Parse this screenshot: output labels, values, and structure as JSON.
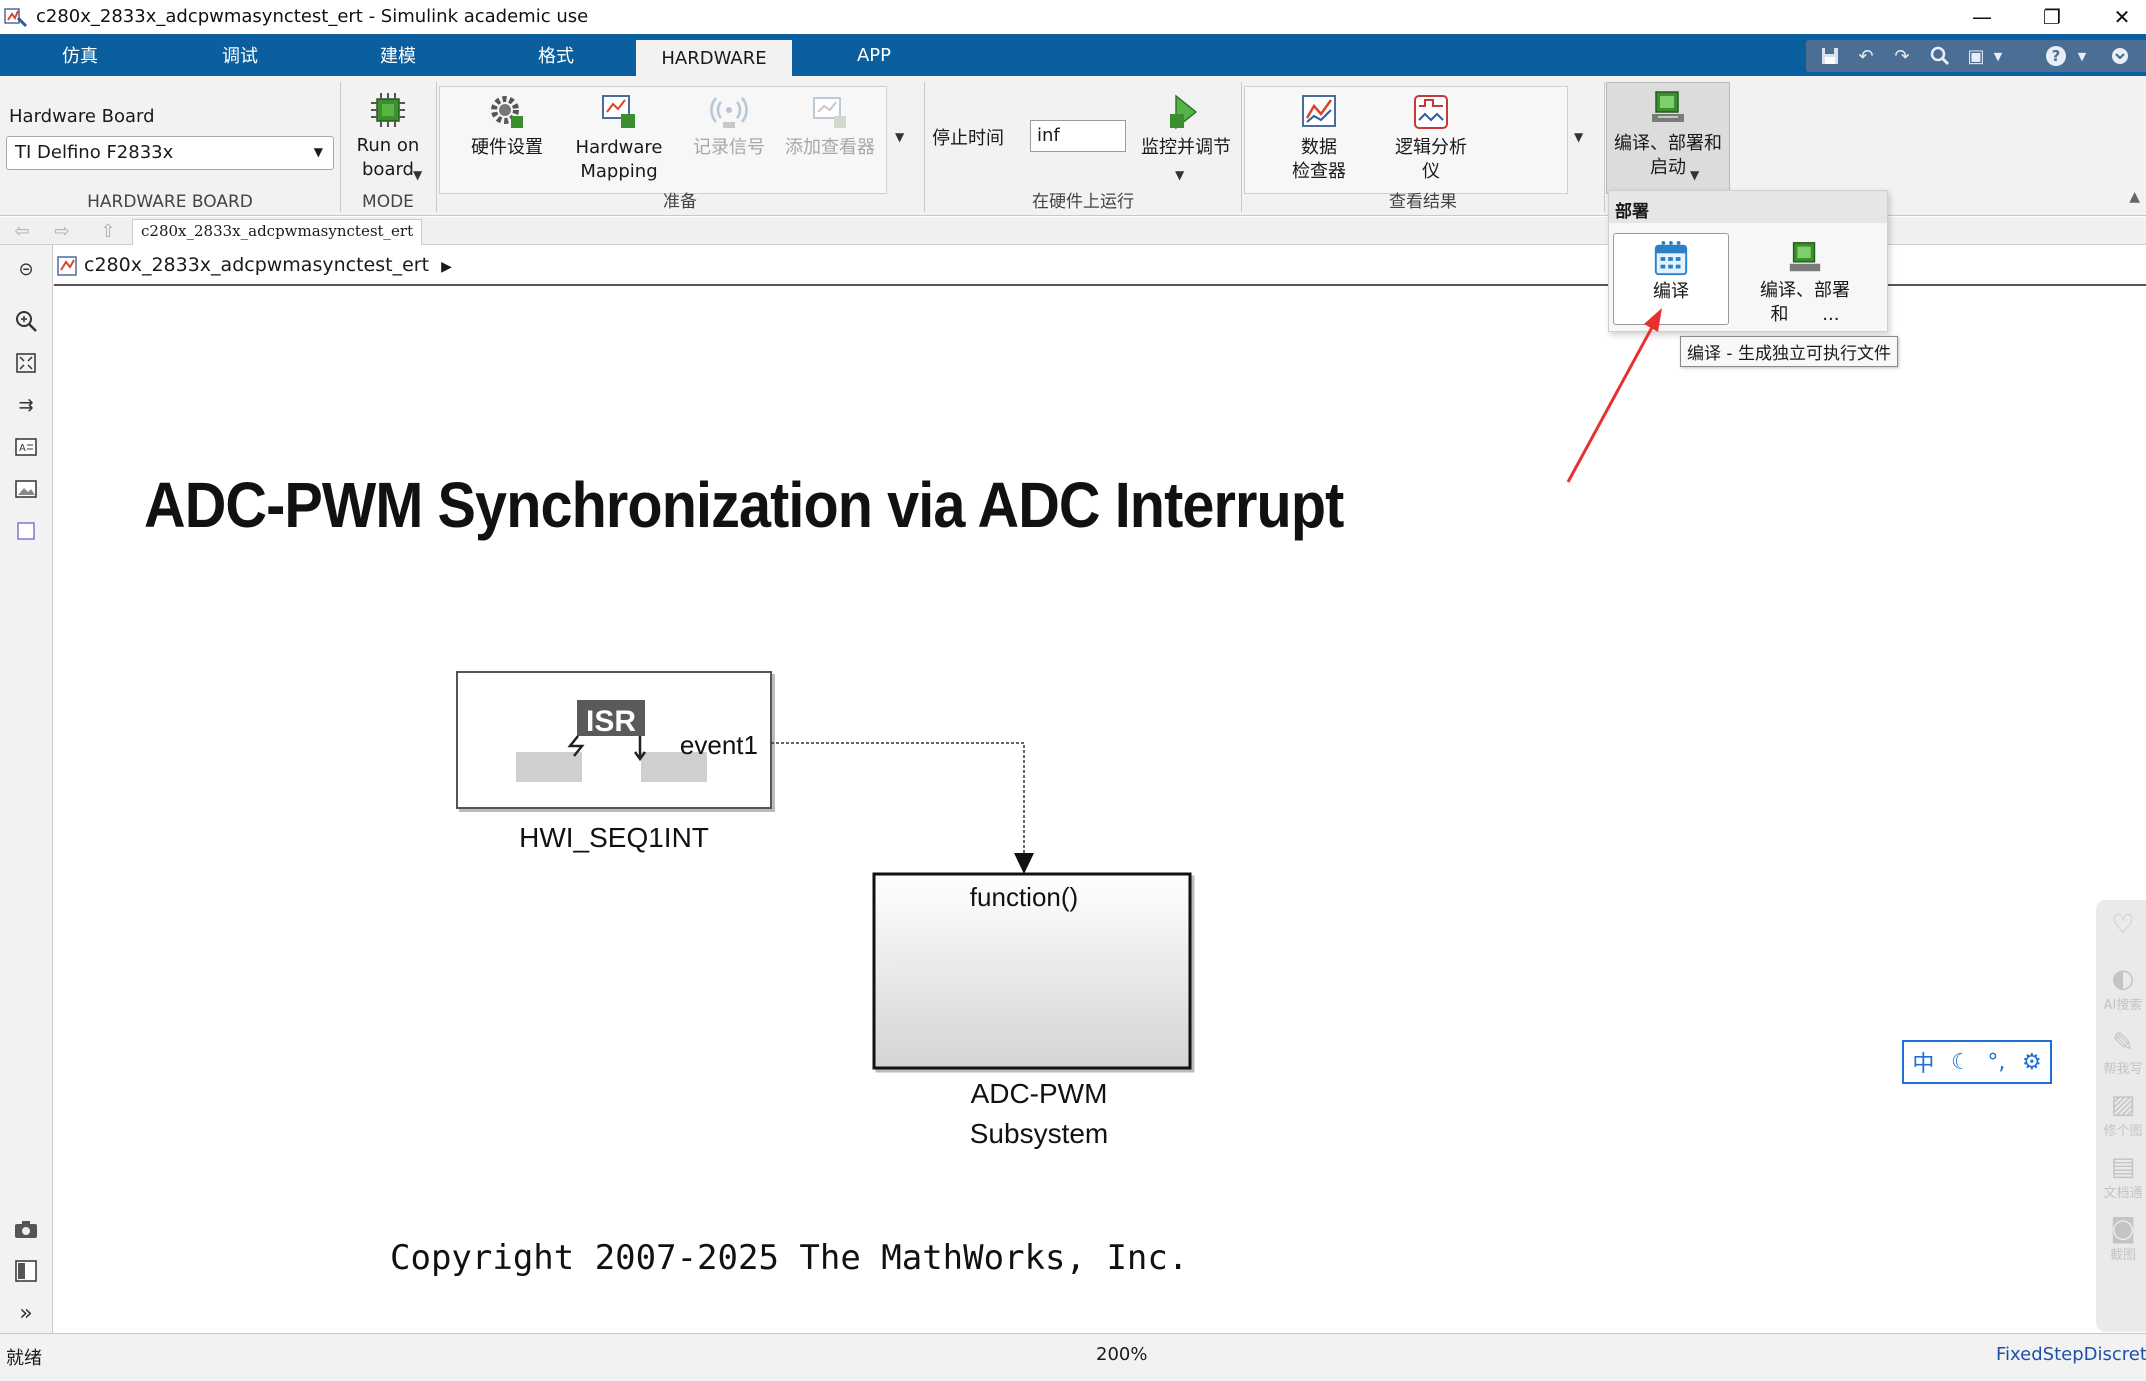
{
  "window": {
    "title": "c280x_2833x_adcpwmasynctest_ert - Simulink academic use",
    "minimize_glyph": "—",
    "restore_glyph": "❐",
    "close_glyph": "✕"
  },
  "tabs": [
    {
      "label": "仿真"
    },
    {
      "label": "调试"
    },
    {
      "label": "建模"
    },
    {
      "label": "格式"
    },
    {
      "label": "HARDWARE",
      "active": true
    },
    {
      "label": "APP"
    }
  ],
  "ribbon": {
    "hardware_board": {
      "label": "Hardware Board",
      "selected": "TI Delfino F2833x",
      "section": "HARDWARE BOARD"
    },
    "mode": {
      "run_on_board_line1": "Run on",
      "run_on_board_line2": "board",
      "section": "MODE"
    },
    "prepare": {
      "hardware_settings": "硬件设置",
      "hardware_mapping_line1": "Hardware",
      "hardware_mapping_line2": "Mapping",
      "log_signals": "记录信号",
      "add_viewer": "添加查看器",
      "section": "准备"
    },
    "run_on_hardware": {
      "stop_time_label": "停止时间",
      "stop_time_value": "inf",
      "monitor_tune": "监控并调节",
      "section": "在硬件上运行"
    },
    "review": {
      "data_inspector_line1": "数据",
      "data_inspector_line2": "检查器",
      "logic_analyzer_line1": "逻辑分析",
      "logic_analyzer_line2": "仪",
      "section": "查看结果"
    },
    "deploy": {
      "build_deploy_line1": "编译、部署和",
      "build_deploy_line2": "启动"
    }
  },
  "deploy_panel": {
    "header": "部署",
    "build": "编译",
    "build_deploy_line1": "编译、部署",
    "build_deploy_line2": "和",
    "build_deploy_more": "...",
    "tooltip": "编译 - 生成独立可执行文件"
  },
  "nav": {
    "tab": "c280x_2833x_adcpwmasynctest_ert",
    "path": "c280x_2833x_adcpwmasynctest_ert",
    "path_caret": "▶"
  },
  "canvas": {
    "heading": "ADC-PWM Synchronization via ADC Interrupt",
    "hwi_block": {
      "isr_text": "ISR",
      "port_label": "event1",
      "name": "HWI_SEQ1INT"
    },
    "subsystem_block": {
      "port_label": "function()",
      "name_line1": "ADC-PWM",
      "name_line2": "Subsystem"
    },
    "copyright": "Copyright 2007-2025 The MathWorks, Inc."
  },
  "status": {
    "ready": "就绪",
    "zoom": "200%",
    "solver": "FixedStepDiscrete"
  },
  "side_tools": [
    {
      "label": "",
      "icon": "heart-icon"
    },
    {
      "label": "AI搜索",
      "icon": "ai-search-icon"
    },
    {
      "label": "帮我写",
      "icon": "write-icon"
    },
    {
      "label": "修个图",
      "icon": "image-edit-icon"
    },
    {
      "label": "文档通",
      "icon": "document-icon"
    },
    {
      "label": "截图",
      "icon": "camera-icon"
    }
  ],
  "ime": {
    "lang": "中",
    "moon": "☾",
    "punct": "°,",
    "gear": "⚙"
  },
  "colors": {
    "tab_bar": "#0c5f9e",
    "annotation_arrow": "#e8312e",
    "ime_accent": "#1f6fd6",
    "solver_link": "#1f4fa8"
  }
}
